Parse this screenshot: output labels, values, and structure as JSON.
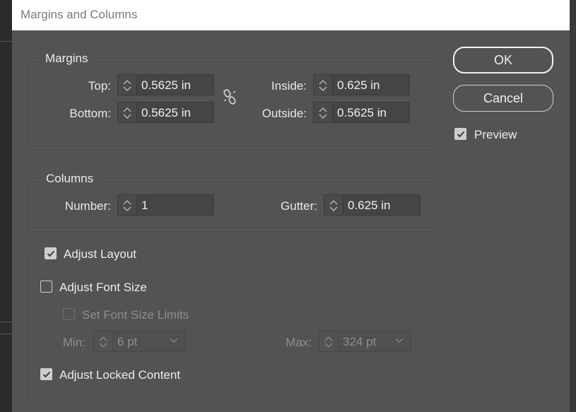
{
  "dialog": {
    "title": "Margins and Columns"
  },
  "margins": {
    "legend": "Margins",
    "top": {
      "label": "Top:",
      "value": "0.5625 in"
    },
    "bottom": {
      "label": "Bottom:",
      "value": "0.5625 in"
    },
    "inside": {
      "label": "Inside:",
      "value": "0.625 in"
    },
    "outside": {
      "label": "Outside:",
      "value": "0.5625 in"
    },
    "link_icon": "broken-chain-link-icon"
  },
  "columns": {
    "legend": "Columns",
    "number": {
      "label": "Number:",
      "value": "1"
    },
    "gutter": {
      "label": "Gutter:",
      "value": "0.625 in"
    }
  },
  "adjust_layout": {
    "label": "Adjust Layout",
    "checked": true,
    "adjust_font_size": {
      "label": "Adjust Font Size",
      "checked": false
    },
    "set_font_size_limits": {
      "label": "Set Font Size Limits",
      "checked": false,
      "enabled": false
    },
    "min": {
      "label": "Min:",
      "value": "6 pt"
    },
    "max": {
      "label": "Max:",
      "value": "324 pt"
    },
    "adjust_locked_content": {
      "label": "Adjust Locked Content",
      "checked": true
    }
  },
  "buttons": {
    "ok": "OK",
    "cancel": "Cancel"
  },
  "preview": {
    "label": "Preview",
    "checked": true
  },
  "colors": {
    "panel": "#535353",
    "field": "#454545",
    "text": "#e6e6e6",
    "titlebar": "#ffffff"
  }
}
